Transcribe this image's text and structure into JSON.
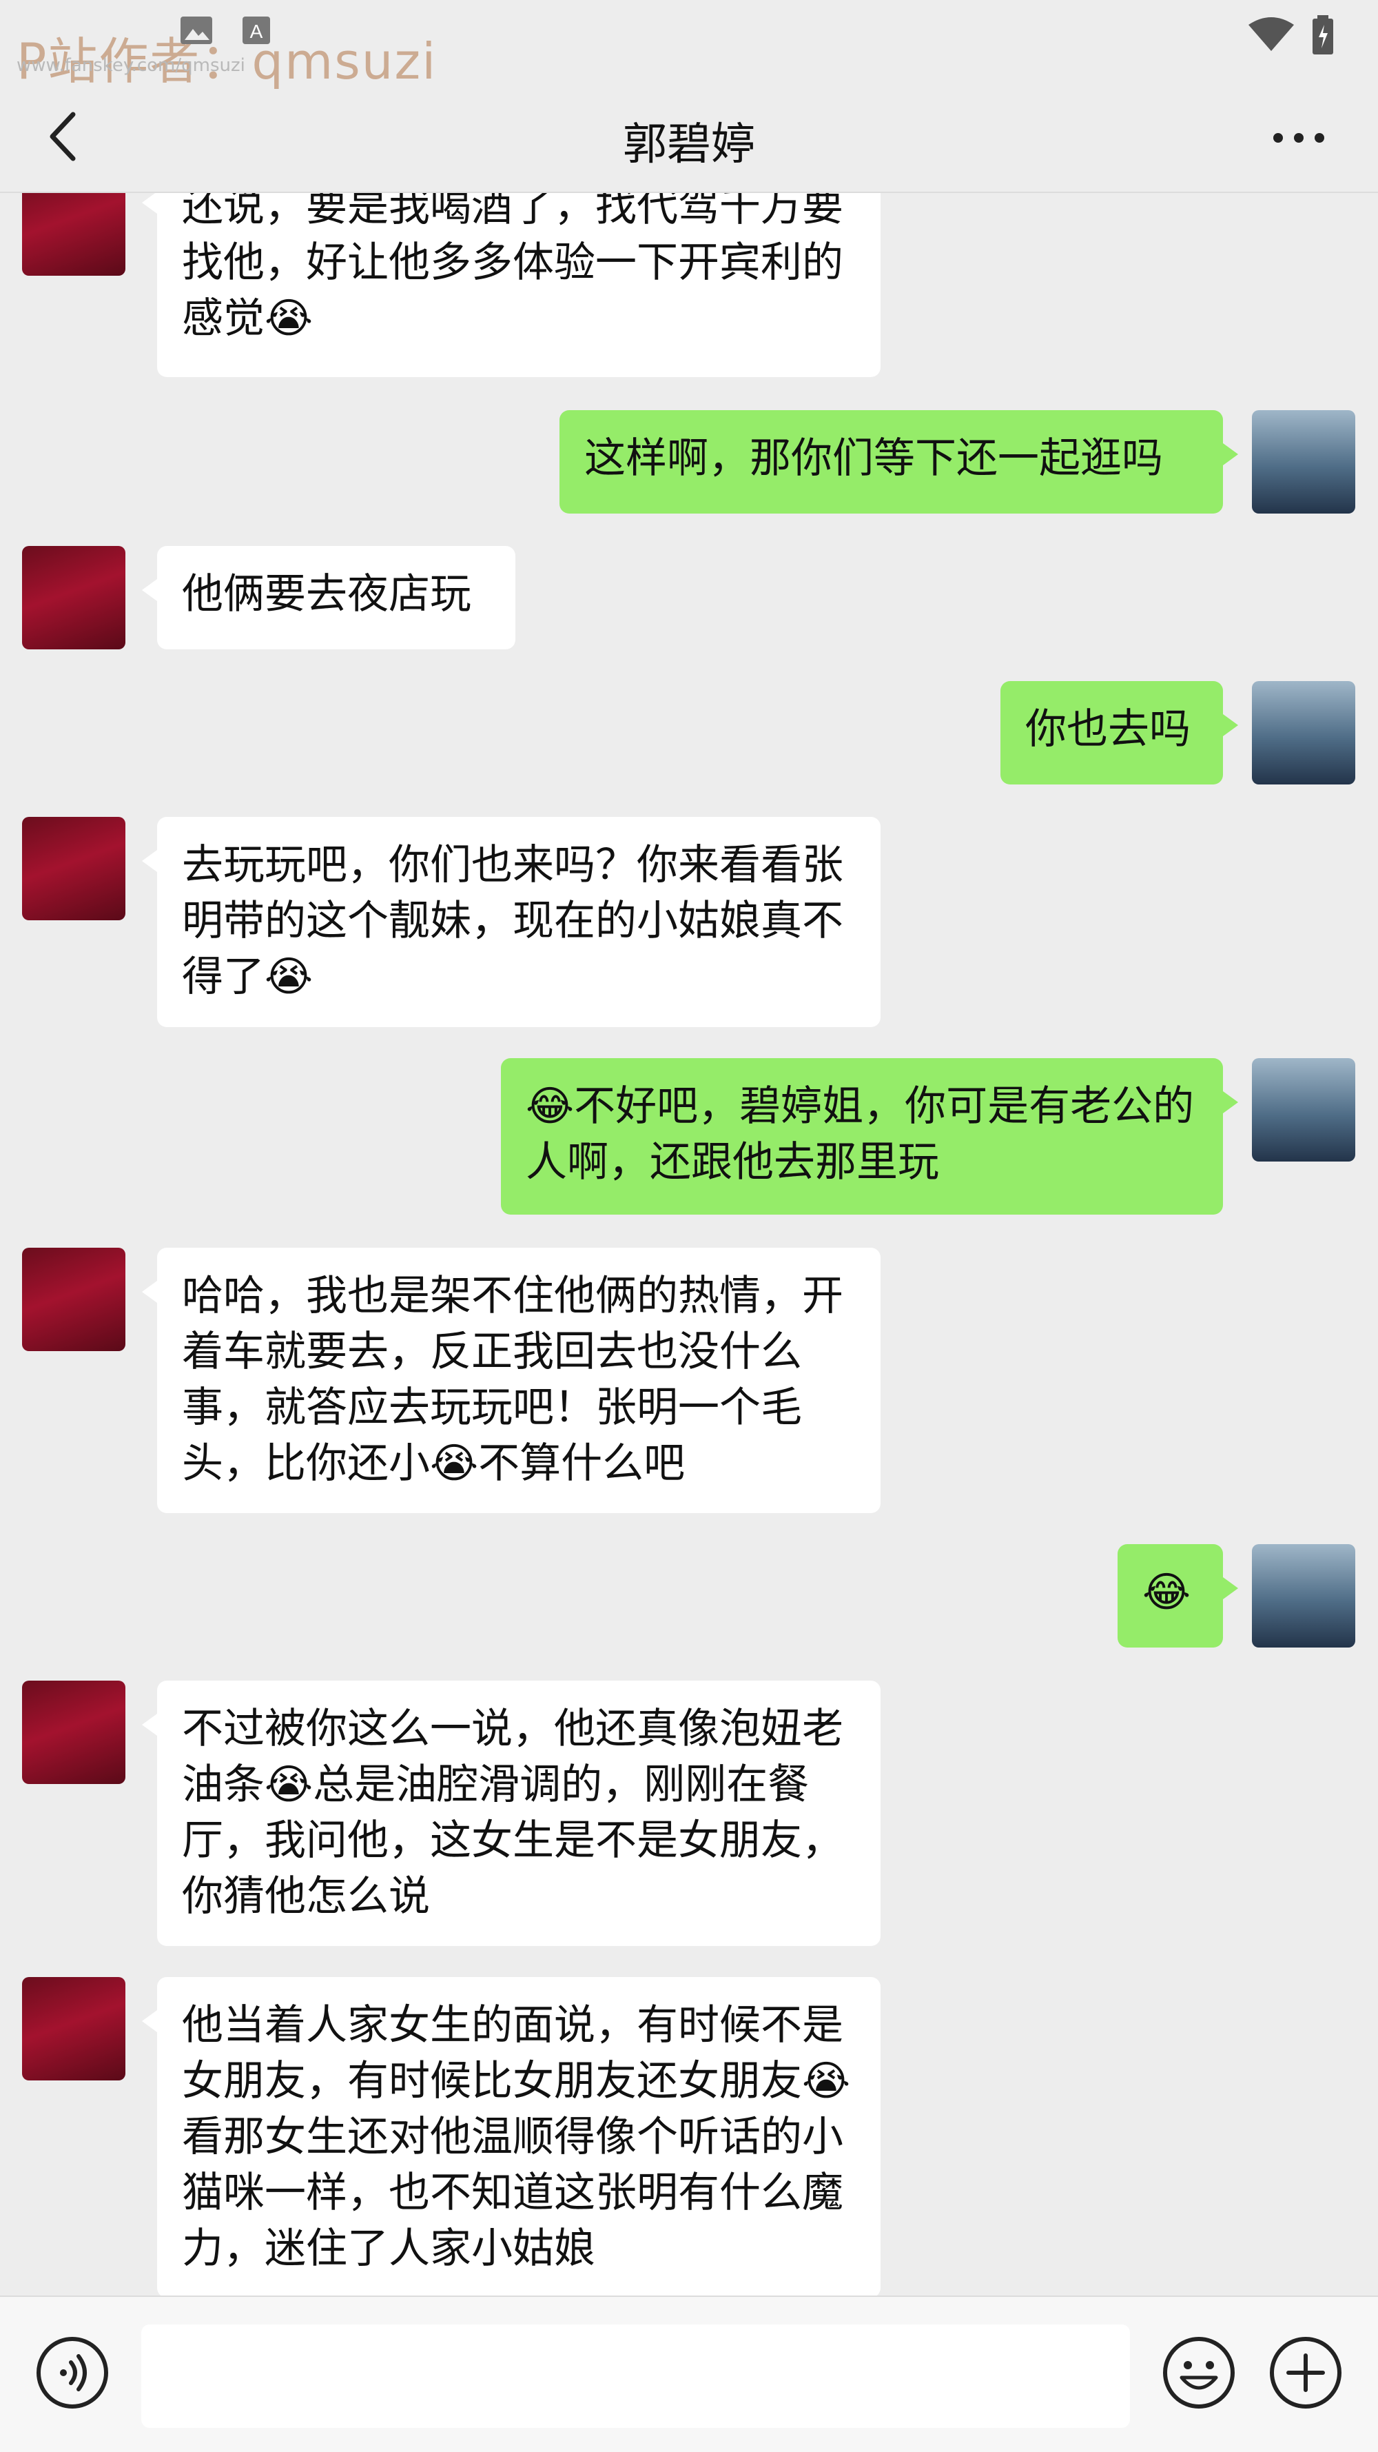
{
  "status_bar": {
    "watermark": "P站作者：qmsuzi",
    "watermark_sub": "www.fanskey.com/qmsuzi",
    "icons": [
      "image-icon",
      "a-notification-icon",
      "wifi-icon",
      "battery-icon"
    ]
  },
  "header": {
    "back_icon": "chevron-left-icon",
    "title": "郭碧婷",
    "more_icon": "more-dots-icon"
  },
  "messages": [
    {
      "side": "left",
      "text": "还说，要是我喝酒了，找代驾千万要找他，好让他多多体验一下开宾利的感觉😭"
    },
    {
      "side": "right",
      "text": "这样啊，那你们等下还一起逛吗"
    },
    {
      "side": "left",
      "text": "他俩要去夜店玩"
    },
    {
      "side": "right",
      "text": "你也去吗"
    },
    {
      "side": "left",
      "text": "去玩玩吧，你们也来吗？你来看看张明带的这个靓妹，现在的小姑娘真不得了😭"
    },
    {
      "side": "right",
      "text": "😂不好吧，碧婷姐，你可是有老公的人啊，还跟他去那里玩"
    },
    {
      "side": "left",
      "text": "哈哈，我也是架不住他俩的热情，开着车就要去，反正我回去也没什么事，就答应去玩玩吧！张明一个毛头，比你还小😭不算什么吧"
    },
    {
      "side": "right",
      "text": "😂"
    },
    {
      "side": "left",
      "text": "不过被你这么一说，他还真像泡妞老油条😭总是油腔滑调的，刚刚在餐厅，我问他，这女生是不是女朋友，你猜他怎么说"
    },
    {
      "side": "left",
      "text": "他当着人家女生的面说，有时候不是女朋友，有时候比女朋友还女朋友😭看那女生还对他温顺得像个听话的小猫咪一样，也不知道这张明有什么魔力，迷住了人家小姑娘"
    }
  ],
  "input_bar": {
    "voice_icon": "voice-icon",
    "text_value": "",
    "emoji_icon": "emoji-icon",
    "plus_icon": "plus-icon"
  },
  "colors": {
    "background": "#ededed",
    "sent_bubble": "#95ec69",
    "received_bubble": "#ffffff",
    "watermark": "#c9a489"
  }
}
